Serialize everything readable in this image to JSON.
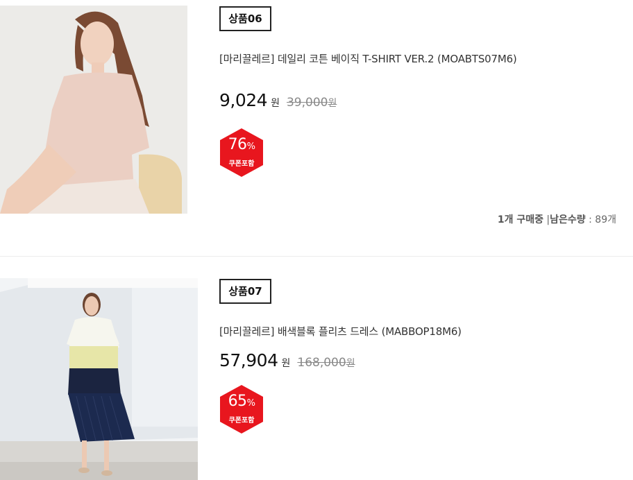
{
  "products": [
    {
      "badge": "상품06",
      "title": "[마리끌레르] 데일리 코튼 베이직 T-SHIRT VER.2 (MOABTS07M6)",
      "sale_price": "9,024",
      "sale_unit": "원",
      "original_price": "39,000",
      "original_unit": "원",
      "discount_percent": "76",
      "discount_sign": "%",
      "discount_label": "쿠폰포함",
      "stock": {
        "buying": "1개 구매중",
        "separator": "|",
        "remaining_label": "남은수량",
        "colon": ":",
        "remaining_value": "89개"
      }
    },
    {
      "badge": "상품07",
      "title": "[마리끌레르] 배색블록 플리츠 드레스 (MABBOP18M6)",
      "sale_price": "57,904",
      "sale_unit": "원",
      "original_price": "168,000",
      "original_unit": "원",
      "discount_percent": "65",
      "discount_sign": "%",
      "discount_label": "쿠폰포함"
    }
  ],
  "colors": {
    "discount_badge": "#e8161e",
    "badge_border": "#222222"
  }
}
